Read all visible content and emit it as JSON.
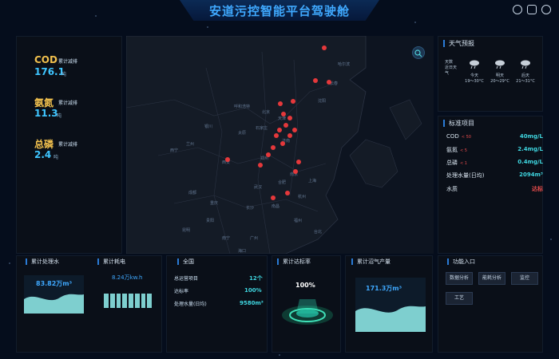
{
  "header": {
    "title": "安道污控智能平台驾驶舱"
  },
  "metrics": [
    {
      "name": "COD",
      "tag": "累计减排",
      "value": "176.1",
      "unit": "吨",
      "color": "#f2c14e"
    },
    {
      "name": "氨氮",
      "tag": "累计减排",
      "value": "11.3",
      "unit": "吨",
      "color": "#f2c14e"
    },
    {
      "name": "总磷",
      "tag": "累计减排",
      "value": "2.4",
      "unit": "吨",
      "color": "#f2c14e"
    }
  ],
  "map": {
    "labels": [
      "哈尔滨",
      "长春",
      "沈阳",
      "呼和浩特",
      "北京",
      "天津",
      "石家庄",
      "太原",
      "银川",
      "兰州",
      "西宁",
      "济南",
      "郑州",
      "西安",
      "南京",
      "上海",
      "武汉",
      "合肥",
      "杭州",
      "成都",
      "重庆",
      "长沙",
      "南昌",
      "福州",
      "贵阳",
      "昆明",
      "南宁",
      "广州",
      "台北",
      "海口"
    ]
  },
  "weather": {
    "title": "天气预报",
    "intro": "天数\n近日天气",
    "days": [
      {
        "day": "今天",
        "temp": "19～30°C"
      },
      {
        "day": "明天",
        "temp": "20～29°C"
      },
      {
        "day": "后天",
        "temp": "21～31°C"
      }
    ]
  },
  "standards": {
    "title": "标准项目",
    "rows": [
      {
        "label": "COD",
        "limit": "< 50",
        "value": "40mg/L"
      },
      {
        "label": "氨氮",
        "limit": "< 5",
        "value": "2.4mg/L"
      },
      {
        "label": "总磷",
        "limit": "< 1",
        "value": "0.4mg/L"
      },
      {
        "label": "处理水量(日均)",
        "limit": "",
        "value": "2094m³"
      },
      {
        "label": "水质",
        "limit": "",
        "value": "达标"
      }
    ]
  },
  "bottom": {
    "water_title": "累计处理水",
    "water_value": "83.82万m³",
    "power_title": "累计耗电",
    "power_value": "8.24万kw.h",
    "national_title": "全国",
    "national_rows": [
      {
        "label": "总运营项目",
        "value": "12个"
      },
      {
        "label": "达标率",
        "value": "100%"
      },
      {
        "label": "处理水量(日均)",
        "value": "9580m³"
      }
    ],
    "rate_title": "累计达标率",
    "rate_value": "100%",
    "gas_title": "累计沼气产量",
    "gas_value": "171.3万m³",
    "func_title": "功能入口",
    "func_buttons": [
      "数据分析",
      "能耗分析",
      "监控",
      "工艺"
    ]
  }
}
